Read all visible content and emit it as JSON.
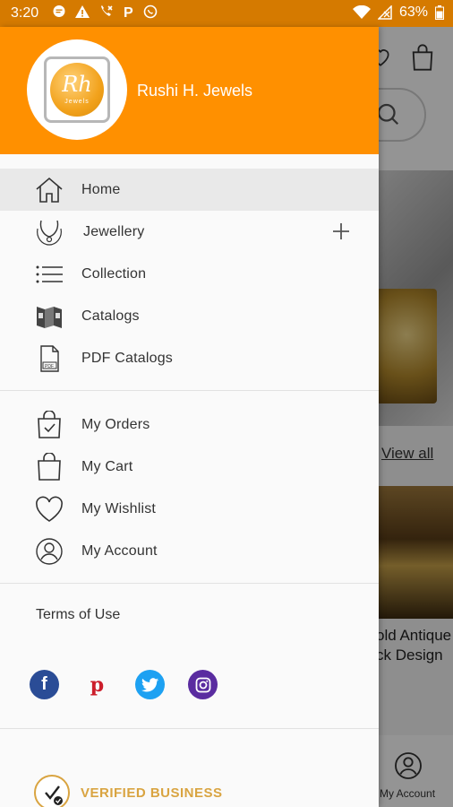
{
  "status_bar": {
    "time": "3:20",
    "battery": "63%",
    "left_icons": [
      "message-icon",
      "warning-icon",
      "call-forwarding-icon",
      "parking-icon",
      "whatsapp-icon"
    ],
    "right_icons": [
      "wifi-icon",
      "no-signal-icon",
      "battery-icon"
    ]
  },
  "drawer": {
    "store_name": "Rushi H. Jewels",
    "logo": {
      "mark": "Rh",
      "sub": "Jewels"
    },
    "primary_menu": [
      {
        "label": "Home",
        "icon": "home-icon",
        "active": true
      },
      {
        "label": "Jewellery",
        "icon": "necklace-icon",
        "expandable": true
      },
      {
        "label": "Collection",
        "icon": "list-icon"
      },
      {
        "label": "Catalogs",
        "icon": "catalog-icon"
      },
      {
        "label": "PDF Catalogs",
        "icon": "pdf-icon"
      }
    ],
    "account_menu": [
      {
        "label": "My Orders",
        "icon": "orders-bag-icon"
      },
      {
        "label": "My Cart",
        "icon": "cart-bag-icon"
      },
      {
        "label": "My Wishlist",
        "icon": "heart-icon"
      },
      {
        "label": "My Account",
        "icon": "account-icon"
      }
    ],
    "terms_label": "Terms of Use",
    "social": [
      "facebook-icon",
      "pinterest-icon",
      "twitter-icon",
      "instagram-icon"
    ],
    "verified_label": "VERIFIED BUSINESS"
  },
  "background": {
    "view_all": "View all",
    "product_title_line1": "old Antique",
    "product_title_line2": "ck Design",
    "bottom_nav_account": "My Account"
  },
  "colors": {
    "header_orange": "#ff9000",
    "status_bar": "#d57a00",
    "verified_gold": "#d9a441"
  }
}
